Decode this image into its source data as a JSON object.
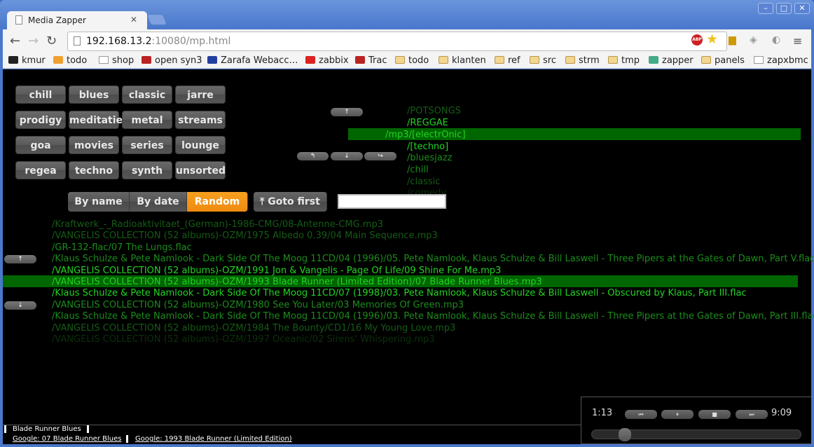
{
  "window": {
    "tab_title": "Media Zapper",
    "url_host": "192.168.13.2",
    "url_rest": ":10080/mp.html"
  },
  "bookmarks": [
    {
      "label": "kmur",
      "icon": "kmur-icon"
    },
    {
      "label": "todo",
      "icon": "check-icon"
    },
    {
      "label": "shop",
      "icon": "page-icon"
    },
    {
      "label": "open syn3",
      "icon": "paw-icon"
    },
    {
      "label": "Zarafa Webacc…",
      "icon": "zarafa-icon"
    },
    {
      "label": "zabbix",
      "icon": "zabbix-icon"
    },
    {
      "label": "Trac",
      "icon": "paw-icon"
    },
    {
      "label": "todo",
      "icon": "folder-icon"
    },
    {
      "label": "klanten",
      "icon": "folder-icon"
    },
    {
      "label": "ref",
      "icon": "folder-icon"
    },
    {
      "label": "src",
      "icon": "folder-icon"
    },
    {
      "label": "strm",
      "icon": "folder-icon"
    },
    {
      "label": "tmp",
      "icon": "folder-icon"
    },
    {
      "label": "zapper",
      "icon": "zapper-icon"
    },
    {
      "label": "panels",
      "icon": "folder-icon"
    },
    {
      "label": "zapxbmc",
      "icon": "page-icon"
    }
  ],
  "genres": [
    "chill",
    "blues",
    "classic",
    "jarre",
    "prodigy",
    "meditatie",
    "metal",
    "streams",
    "goa",
    "movies",
    "series",
    "lounge",
    "regea",
    "techno",
    "synth",
    "unsorted"
  ],
  "sort": {
    "by_name": "By name",
    "by_date": "By date",
    "random": "Random",
    "active": "random",
    "goto_first": "Goto first",
    "search_value": ""
  },
  "arrows": {
    "up": "↑",
    "down": "↓",
    "back": "↰",
    "forward": "↪"
  },
  "dirs": [
    {
      "text": "/POTSONGS",
      "level": 1
    },
    {
      "text": "/REGGAE",
      "level": 3
    },
    {
      "text": "/mp3/[electrOnic]",
      "level": 3,
      "selected": true
    },
    {
      "text": "/[techno]",
      "level": 3
    },
    {
      "text": "/bluesjazz",
      "level": 2
    },
    {
      "text": "/chill",
      "level": 2
    },
    {
      "text": "/classic",
      "level": 1
    },
    {
      "text": "/comedy",
      "level": 0
    }
  ],
  "files": [
    {
      "text": "/Kraftwerk_-_Radioaktivitaet_(German)-1986-CMG/08-Antenne-CMG.mp3",
      "level": 1
    },
    {
      "text": "/VANGELIS COLLECTION (52 albums)-OZM/1975 Albedo 0.39/04 Main Sequence.mp3",
      "level": 1
    },
    {
      "text": "/GR-132-flac/07 The Lungs.flac",
      "level": 2
    },
    {
      "text": "/Klaus Schulze & Pete Namlook - Dark Side Of The Moog 11CD/04 (1996)/05. Pete Namlook, Klaus Schulze & Bill Laswell - Three Pipers at the Gates of Dawn, Part V.flac",
      "level": 2
    },
    {
      "text": "/VANGELIS COLLECTION (52 albums)-OZM/1991 Jon & Vangelis - Page Of Life/09 Shine For Me.mp3",
      "level": 3
    },
    {
      "text": "/VANGELIS COLLECTION (52 albums)-OZM/1993 Blade Runner (Limited Edition)/07 Blade Runner Blues.mp3",
      "level": 3,
      "selected": true
    },
    {
      "text": "/Klaus Schulze & Pete Namlook - Dark Side Of The Moog 11CD/07 (1998)/03. Pete Namlook, Klaus Schulze & Bill Laswell - Obscured by Klaus, Part III.flac",
      "level": 3
    },
    {
      "text": "/VANGELIS COLLECTION (52 albums)-OZM/1980 See You Later/03 Memories Of Green.mp3",
      "level": 2
    },
    {
      "text": "/Klaus Schulze & Pete Namlook - Dark Side Of The Moog 11CD/04 (1996)/03. Pete Namlook, Klaus Schulze & Bill Laswell - Three Pipers at the Gates of Dawn, Part III.flac",
      "level": 2
    },
    {
      "text": "/VANGELIS COLLECTION (52 albums)-OZM/1984 The Bounty/CD1/16 My Young Love.mp3",
      "level": 1
    },
    {
      "text": "/VANGELIS COLLECTION (52 albums)-OZM/1997 Oceanic/02 Sirens' Whispering.mp3",
      "level": 0
    }
  ],
  "status": {
    "title": "Blade Runner Blues",
    "link1": "Google: 07 Blade Runner Blues",
    "link2": "Google: 1993 Blade Runner (Limited Edition)"
  },
  "player": {
    "elapsed": "1:13",
    "duration": "9:09",
    "progress": 0.134,
    "prev": "⏮",
    "pause": "⏸",
    "stop": "■",
    "next": "⏭"
  },
  "colors": {
    "accent": "#f08c10",
    "selected_bg": "#006600",
    "text_bright": "#22d422"
  }
}
